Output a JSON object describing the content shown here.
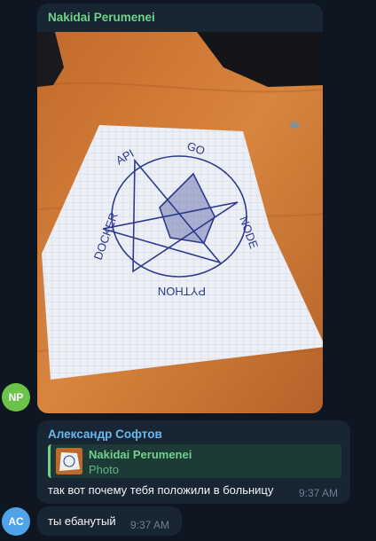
{
  "colors": {
    "background": "#0e1621",
    "bubble": "#182533",
    "np_avatar": "#6cc34a",
    "ac_avatar": "#4fa3e8",
    "sender_green": "#6fd38a",
    "sender_blue": "#69b9f1"
  },
  "messages": [
    {
      "sender": "Nakidai Perumenei",
      "avatar_initials": "NP",
      "has_photo": true
    },
    {
      "sender": "Александр Софтов",
      "avatar_initials": "AC",
      "reply": {
        "sender": "Nakidai Perumenei",
        "label": "Photo"
      },
      "text": "так вот почему тебя положили в больницу",
      "time": "9:37 AM"
    },
    {
      "text": "ты ебанутый",
      "time": "9:37 AM"
    }
  ],
  "photo": {
    "drawing_labels": [
      "API",
      "GO",
      "NODE",
      "PYTHON",
      "DOCKER"
    ]
  }
}
